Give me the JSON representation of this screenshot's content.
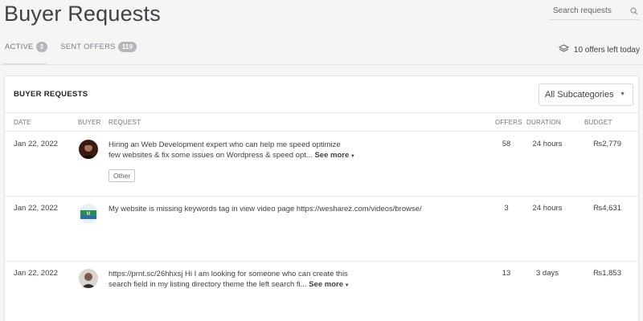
{
  "page": {
    "title": "Buyer Requests"
  },
  "search": {
    "placeholder": "Search requests"
  },
  "tabs": [
    {
      "label": "ACTIVE",
      "count": "3"
    },
    {
      "label": "SENT OFFERS",
      "count": "119"
    }
  ],
  "offers_left": "10 offers left today",
  "card": {
    "title": "BUYER REQUESTS",
    "subcategory": "All Subcategories",
    "columns": [
      "DATE",
      "BUYER",
      "REQUEST",
      "OFFERS",
      "DURATION",
      "BUDGET"
    ],
    "rows": [
      {
        "date": "Jan 22, 2022",
        "request_line1": "Hiring an Web Development expert who can help me speed optimize",
        "request_line2": "few websites & fix some issues on Wordpress & speed opt...",
        "see_more": "See more",
        "tag": "Other",
        "offers": "58",
        "duration": "24 hours",
        "budget": "₨2,779"
      },
      {
        "date": "Jan 22, 2022",
        "request_line1": "My website is missing keywords tag in view video page https://wesharez.com/videos/browse/",
        "offers": "3",
        "duration": "24 hours",
        "budget": "₨4,631"
      },
      {
        "date": "Jan 22, 2022",
        "request_line1": "https://prnt.sc/26hhxsj Hi I am looking for someone who can create this",
        "request_line2": "search field in my listing directory theme the left search fi...",
        "see_more": "See more",
        "offers": "13",
        "duration": "3 days",
        "budget": "₨1,853"
      }
    ]
  },
  "colors": {
    "accent": "#404145",
    "badge": "#b5b6ba",
    "border": "#e4e5e7"
  },
  "icons": {
    "search": "search-icon",
    "offers": "layers-icon",
    "caret": "chevron-down-icon"
  }
}
